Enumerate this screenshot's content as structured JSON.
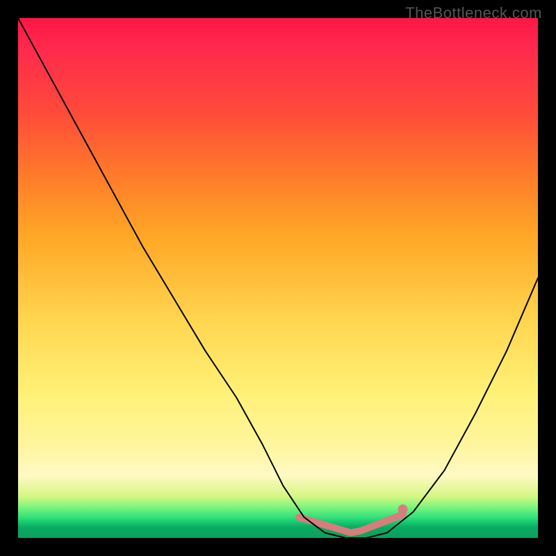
{
  "watermark": "TheBottleneck.com",
  "chart_data": {
    "type": "line",
    "title": "",
    "xlabel": "",
    "ylabel": "",
    "xlim": [
      0,
      100
    ],
    "ylim": [
      0,
      100
    ],
    "background": "rainbow-vertical (red top → green bottom, value = distance-from-optimum heatmap)",
    "series": [
      {
        "name": "bottleneck-curve",
        "x": [
          0,
          6,
          12,
          18,
          24,
          30,
          36,
          42,
          47,
          51,
          55,
          59,
          63,
          67,
          71,
          76,
          82,
          88,
          94,
          100
        ],
        "y": [
          100,
          89,
          78,
          67,
          56,
          46,
          36,
          27,
          18,
          10,
          4,
          1,
          0,
          0,
          1,
          5,
          13,
          24,
          36,
          50
        ]
      }
    ],
    "highlighted_region": {
      "description": "optimum low-bottleneck zone (salmon segment + endpoint dot)",
      "x_range": [
        54,
        74
      ],
      "y_approx": 1
    }
  }
}
